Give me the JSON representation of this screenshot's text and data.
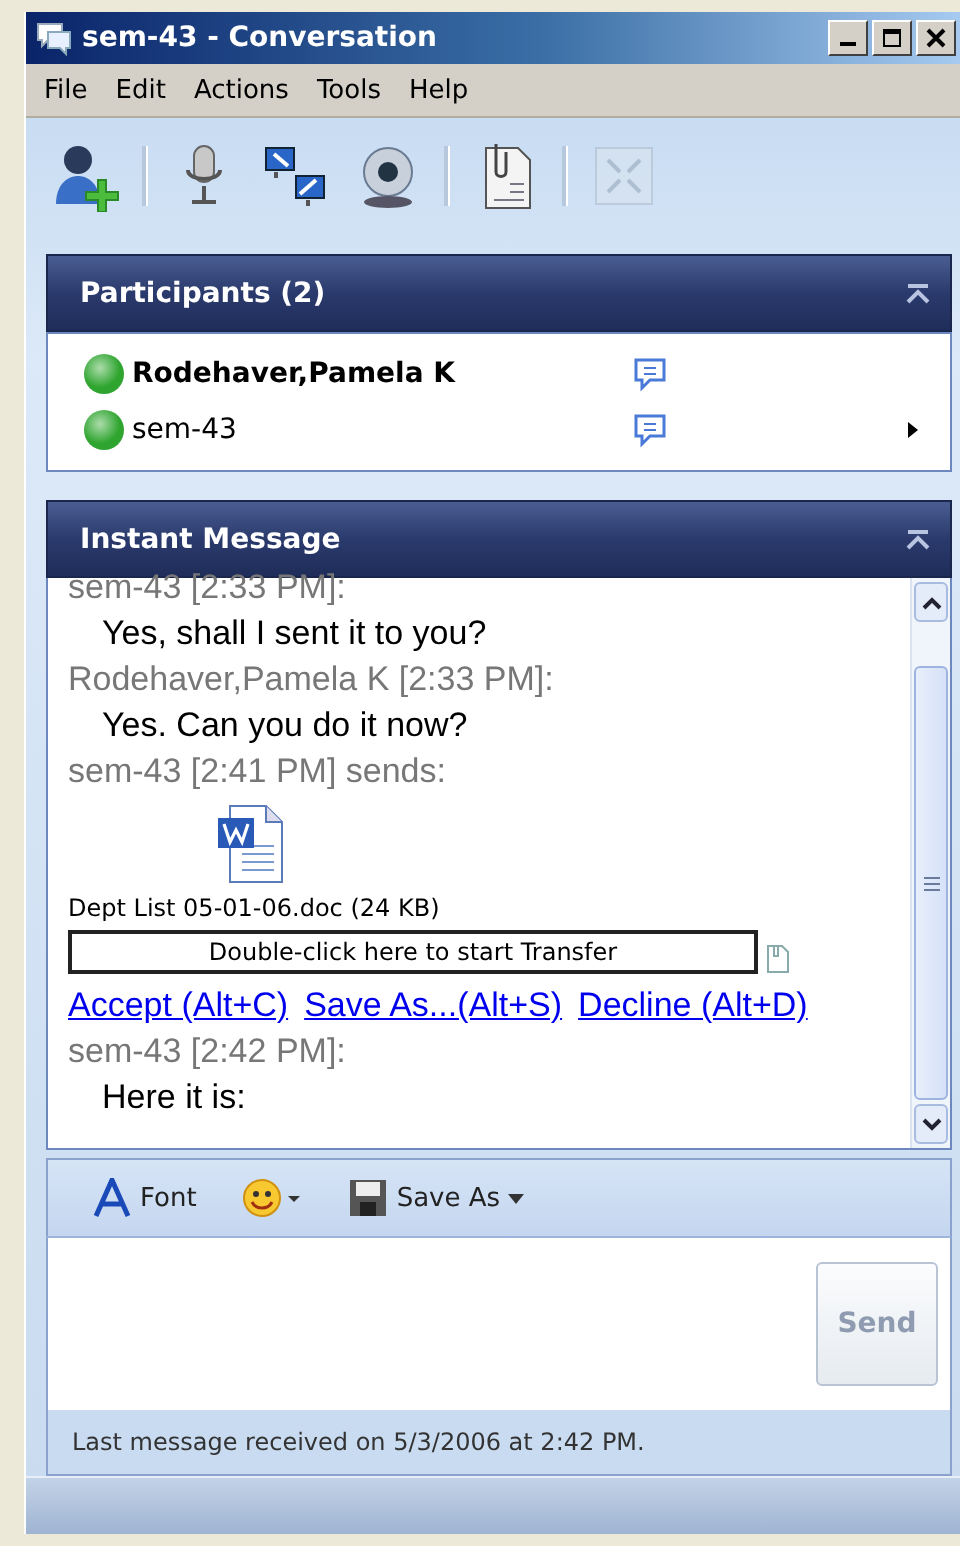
{
  "window": {
    "title": "sem-43 - Conversation"
  },
  "menu": [
    "File",
    "Edit",
    "Actions",
    "Tools",
    "Help"
  ],
  "toolbar": [
    {
      "disabled": false
    },
    {
      "disabled": false
    },
    {
      "disabled": false
    },
    {
      "disabled": false
    },
    {
      "disabled": false
    },
    {
      "disabled": true
    }
  ],
  "participants": {
    "title": "Participants (2)",
    "expanded": true,
    "items": [
      {
        "name": "Rodehaver,Pamela K",
        "selected": true,
        "color": "#2fa52f",
        "menu_arrow": false
      },
      {
        "name": "sem-43",
        "selected": false,
        "color": "#2fa52f",
        "menu_arrow": true
      }
    ]
  },
  "instant_message": {
    "title": "Instant Message",
    "expanded": true,
    "messages": [
      {
        "kind": "header",
        "text": "sem-43 [2:33 PM]:"
      },
      {
        "kind": "body",
        "text": "Yes, shall I sent it to you?"
      },
      {
        "kind": "header",
        "text": "Rodehaver,Pamela K [2:33 PM]:"
      },
      {
        "kind": "body",
        "text": "Yes. Can you do it now?"
      },
      {
        "kind": "header",
        "text": "sem-43 [2:41 PM] sends:"
      },
      {
        "kind": "file",
        "file_name": "Dept List 05-01-06.doc (24 KB)",
        "transfer": "Double-click here to start Transfer",
        "links": [
          "Accept (Alt+C)",
          "Save As...(Alt+S)",
          "Decline (Alt+D)"
        ]
      },
      {
        "kind": "header",
        "text": "sem-43 [2:42 PM]:"
      },
      {
        "kind": "body",
        "text": "Here it is:"
      }
    ]
  },
  "format_toolbar": {
    "font": "Font",
    "save_as": "Save As"
  },
  "send_button": {
    "label": "Send",
    "disabled": true
  },
  "status_bar": "Last message received on 5/3/2006 at 2:42 PM."
}
